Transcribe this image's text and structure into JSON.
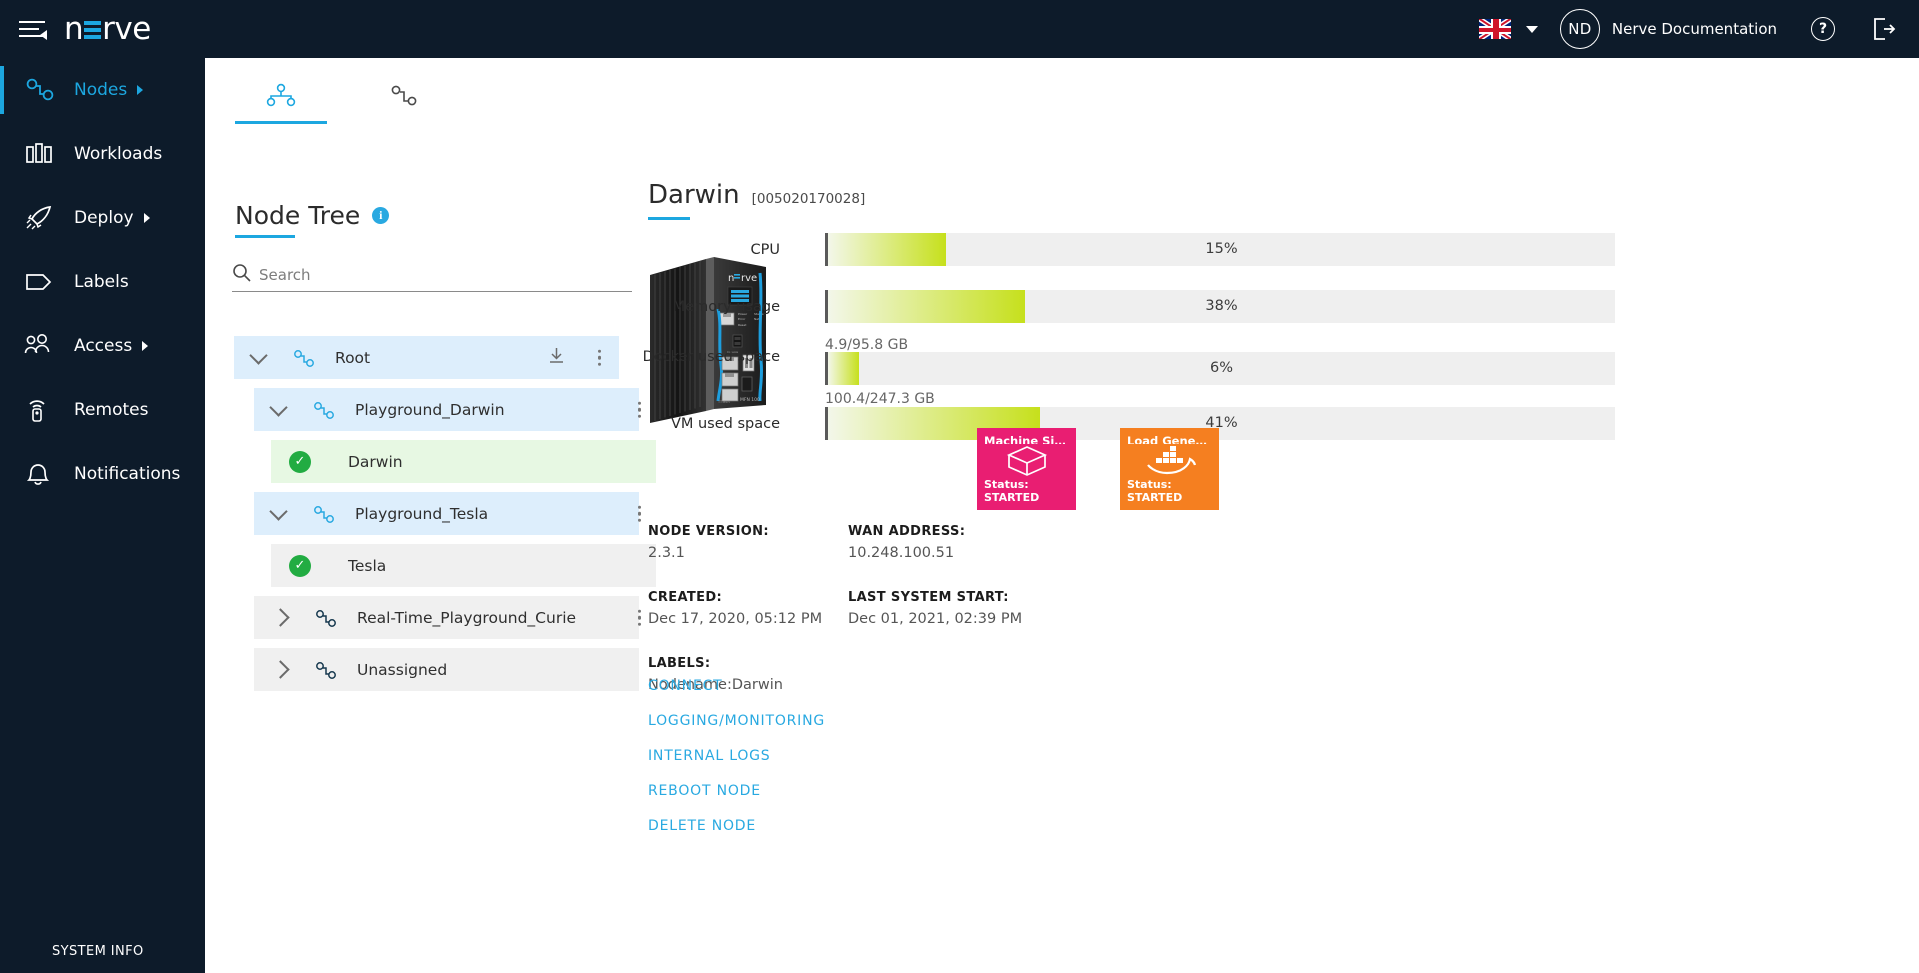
{
  "topbar": {
    "brand_pre": "n",
    "brand_post": "rve",
    "language": "english-flag",
    "user_initials": "ND",
    "username": "Nerve Documentation",
    "help": "?",
    "icons": {
      "menu": "hamburger-icon",
      "dropdown": "chevron-down-icon",
      "help": "help-circle-icon",
      "logout": "logout-icon"
    }
  },
  "sidebar": {
    "items": [
      {
        "label": "Nodes",
        "icon": "nodes-icon",
        "active": true,
        "has_arrow": true
      },
      {
        "label": "Workloads",
        "icon": "workloads-icon",
        "active": false,
        "has_arrow": false
      },
      {
        "label": "Deploy",
        "icon": "rocket-icon",
        "active": false,
        "has_arrow": true
      },
      {
        "label": "Labels",
        "icon": "tag-icon",
        "active": false,
        "has_arrow": false
      },
      {
        "label": "Access",
        "icon": "users-icon",
        "active": false,
        "has_arrow": true
      },
      {
        "label": "Remotes",
        "icon": "remote-icon",
        "active": false,
        "has_arrow": false
      },
      {
        "label": "Notifications",
        "icon": "bell-icon",
        "active": false,
        "has_arrow": false
      }
    ],
    "system_info": "SYSTEM INFO"
  },
  "tabs": [
    {
      "name": "node-tree-tab",
      "icon": "node-tree-icon",
      "active": true
    },
    {
      "name": "node-list-tab",
      "icon": "node-list-icon",
      "active": false
    }
  ],
  "tree_panel": {
    "title": "Node Tree",
    "info_badge": "i",
    "search_placeholder": "Search",
    "search_value": "",
    "nodes": [
      {
        "label": "Root",
        "type": "folder",
        "expanded": true,
        "indent": 0,
        "selected": true,
        "kebab": true,
        "download": true
      },
      {
        "label": "Playground_Darwin",
        "type": "folder",
        "expanded": true,
        "indent": 1,
        "selected": true,
        "kebab": true,
        "download": false
      },
      {
        "label": "Darwin",
        "type": "node",
        "status": "online",
        "indent": 2,
        "selected": "active",
        "kebab": false,
        "download": false
      },
      {
        "label": "Playground_Tesla",
        "type": "folder",
        "expanded": true,
        "indent": 1,
        "selected": true,
        "kebab": true,
        "download": false
      },
      {
        "label": "Tesla",
        "type": "node",
        "status": "online",
        "indent": 2,
        "selected": false,
        "kebab": false,
        "download": false
      },
      {
        "label": "Real-Time_Playground_Curie",
        "type": "folder",
        "expanded": false,
        "indent": 1,
        "selected": false,
        "kebab": true,
        "download": false
      },
      {
        "label": "Unassigned",
        "type": "folder",
        "expanded": false,
        "indent": 1,
        "selected": false,
        "kebab": false,
        "download": false
      }
    ]
  },
  "node_detail": {
    "name": "Darwin",
    "serial": "[005020170028]",
    "device_image": "nerve-mfn-100-device",
    "metrics": [
      {
        "label": "CPU",
        "percent": 15,
        "percent_text": "15%",
        "sub": ""
      },
      {
        "label": "Memory usage",
        "percent": 38,
        "percent_text": "38%",
        "sub": ""
      },
      {
        "label": "Docker used space",
        "percent": 6,
        "percent_text": "6%",
        "sub": "4.9/95.8 GB"
      },
      {
        "label": "VM used space",
        "percent": 41,
        "percent_text": "41%",
        "sub": "100.4/247.3 GB"
      }
    ],
    "info": [
      {
        "key": "NODE VERSION:",
        "value": "2.3.1"
      },
      {
        "key": "WAN ADDRESS:",
        "value": "10.248.100.51"
      },
      {
        "key": "CREATED:",
        "value": "Dec 17, 2020, 05:12 PM"
      },
      {
        "key": "LAST SYSTEM START:",
        "value": "Dec 01, 2021, 02:39 PM"
      },
      {
        "key": "LABELS:",
        "value": "Nodename:Darwin"
      }
    ],
    "actions": [
      "CONNECT",
      "LOGGING/MONITORING",
      "INTERNAL LOGS",
      "REBOOT NODE",
      "DELETE NODE"
    ],
    "workloads": [
      {
        "name": "Machine Simu...",
        "status_label": "Status:",
        "status_value": "STARTED",
        "color": "#e91e72",
        "icon": "cube-icon"
      },
      {
        "name": "Load Generat...",
        "status_label": "Status:",
        "status_value": "STARTED",
        "color": "#f57f20",
        "icon": "docker-icon"
      }
    ]
  },
  "colors": {
    "accent": "#1ca7e0",
    "dark": "#0d1b2a",
    "bar_fill": "#c6e01c",
    "online": "#22ac42",
    "selected_row": "#ddeefc",
    "active_row": "#e7f8e3"
  }
}
